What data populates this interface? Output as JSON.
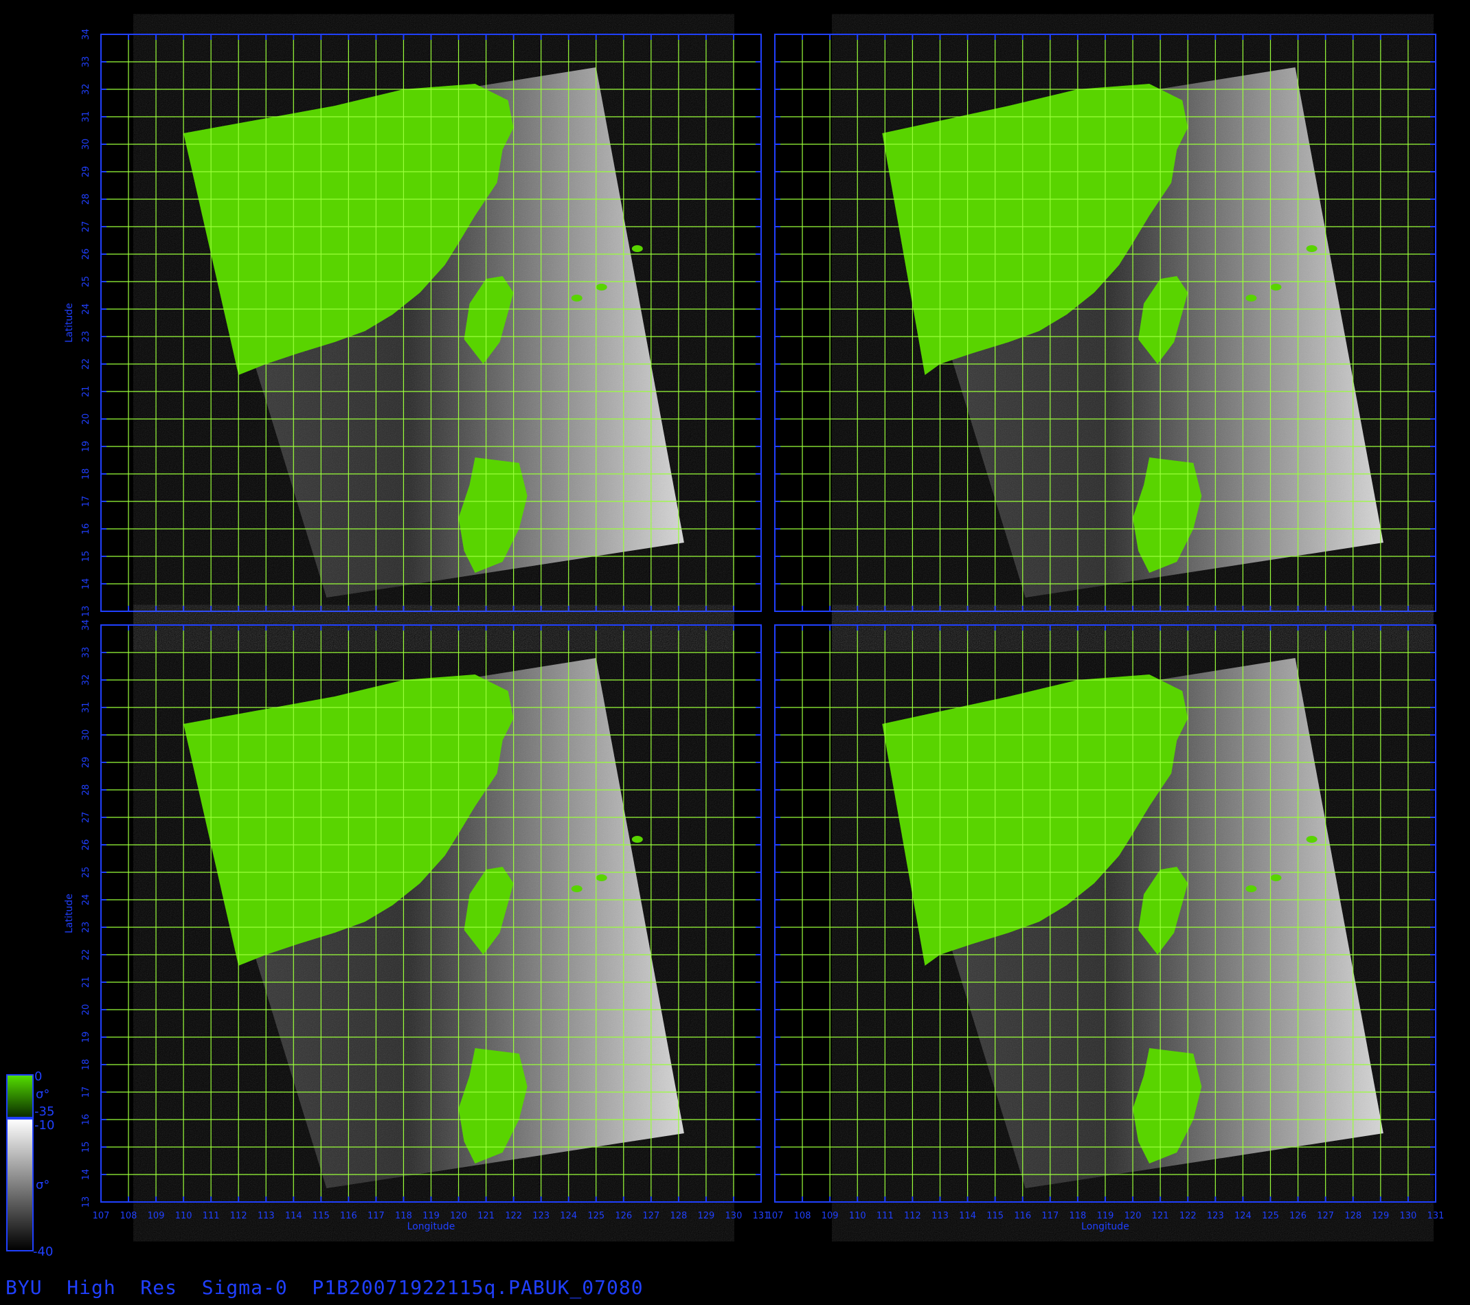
{
  "caption": "BYU  High  Res  Sigma-0  P1B20071922115q.PABUK_07080",
  "axes": {
    "xlabel": "Longitude",
    "ylabel": "Latitude",
    "lon_range": [
      107,
      131
    ],
    "lat_range": [
      13,
      34
    ],
    "lon_ticks": [
      107,
      108,
      109,
      110,
      111,
      112,
      113,
      114,
      115,
      116,
      117,
      118,
      119,
      120,
      121,
      122,
      123,
      124,
      125,
      126,
      127,
      128,
      129,
      130,
      131
    ],
    "lat_ticks": [
      13,
      14,
      15,
      16,
      17,
      18,
      19,
      20,
      21,
      22,
      23,
      24,
      25,
      26,
      27,
      28,
      29,
      30,
      31,
      32,
      33,
      34
    ]
  },
  "colorbar": {
    "land": {
      "max": "0",
      "symbol": "σ°",
      "min": "-35",
      "color": "#4fd000"
    },
    "ocean": {
      "max": "-10",
      "symbol": "σ°",
      "min": "-40"
    }
  },
  "colors": {
    "frame": "#2040ff",
    "grid": "#9aff3a",
    "land": "#59d400",
    "background": "#000000"
  },
  "panels": [
    {
      "id": "top-left"
    },
    {
      "id": "top-right"
    },
    {
      "id": "bottom-left"
    },
    {
      "id": "bottom-right"
    }
  ]
}
